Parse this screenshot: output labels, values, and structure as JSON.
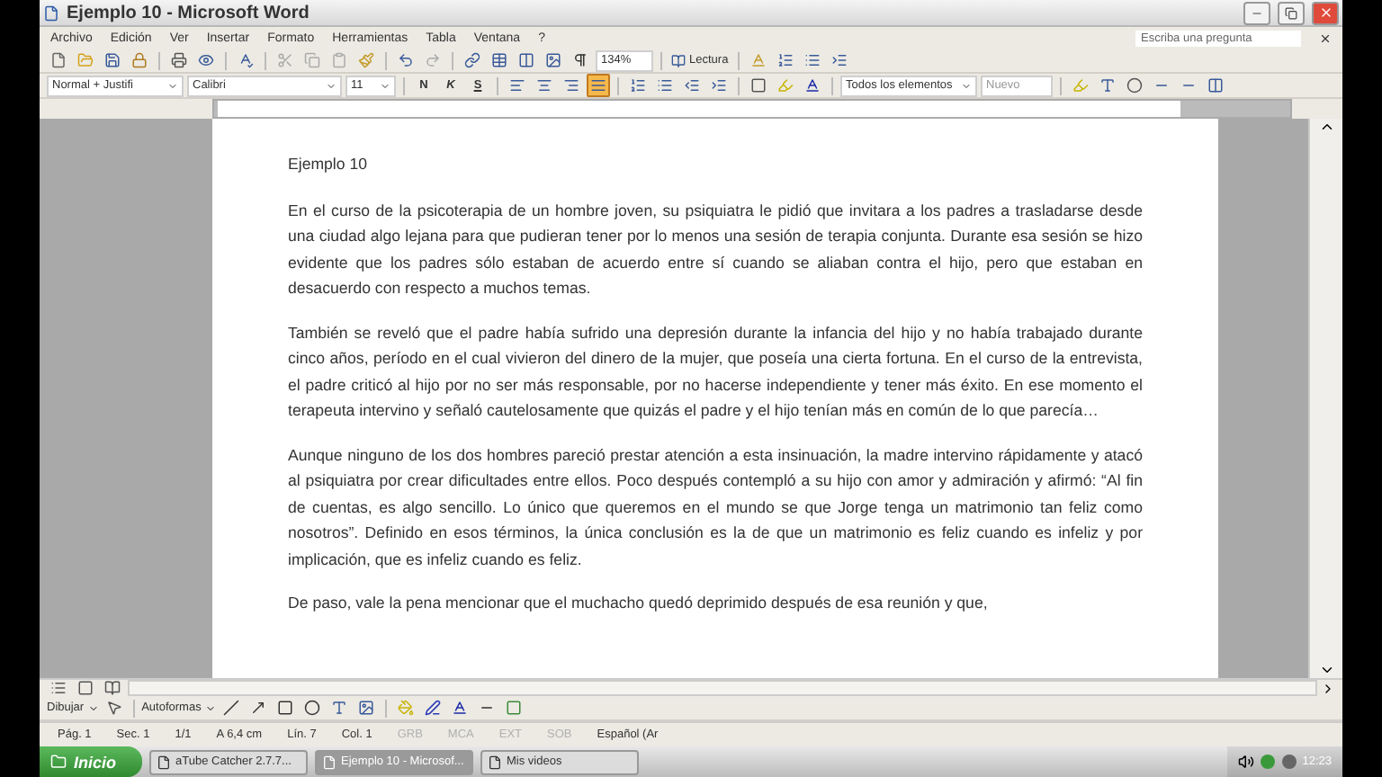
{
  "window": {
    "title": "Ejemplo 10 - Microsoft Word"
  },
  "menu": {
    "items": [
      "Archivo",
      "Edición",
      "Ver",
      "Insertar",
      "Formato",
      "Herramientas",
      "Tabla",
      "Ventana",
      "?"
    ],
    "help_box": {
      "placeholder": "Escriba una pregunta"
    }
  },
  "standard_toolbar": {
    "zoom": "134%",
    "reading_button": "Lectura"
  },
  "format_toolbar": {
    "style": "Normal + Justifi",
    "font": "Calibri",
    "size": "11",
    "bold": "N",
    "italic": "K",
    "underline": "S",
    "alignment_buttons": [
      {
        "selected": false
      },
      {
        "selected": false
      },
      {
        "selected": false
      },
      {
        "selected": true
      }
    ],
    "review_filter": "Todos los elementos",
    "new_comment": "Nuevo"
  },
  "document": {
    "heading": "Ejemplo 10",
    "paragraphs": [
      "En el curso de la psicoterapia de un hombre joven, su psiquiatra le pidió que invitara a los padres a trasladarse desde una ciudad algo lejana para que pudieran tener por lo menos una sesión de terapia conjunta.  Durante esa sesión se hizo evidente que los padres sólo estaban de acuerdo entre sí cuando se aliaban contra el hijo, pero que estaban en desacuerdo con respecto a muchos temas.",
      "También se reveló que el padre había sufrido una depresión durante la infancia del hijo y no había trabajado durante cinco años, período en el cual vivieron del dinero de la mujer, que poseía una cierta fortuna.  En el curso de la entrevista, el padre criticó al hijo por no ser más responsable, por no hacerse independiente y tener más éxito.  En ese momento el terapeuta intervino y señaló cautelosamente que quizás el padre y el hijo tenían más en común de lo que parecía…",
      "Aunque ninguno de los dos hombres pareció prestar atención a esta insinuación, la madre intervino rápidamente y atacó al psiquiatra por crear dificultades entre ellos.  Poco después contempló a su hijo con amor y admiración y afirmó: “Al fin de cuentas, es algo sencillo.  Lo único que queremos en el mundo se que Jorge tenga un matrimonio tan feliz como nosotros”. Definido en esos términos, la única conclusión es la de que un matrimonio es feliz cuando es infeliz y por implicación, que es infeliz cuando es feliz.",
      "De paso, vale la pena mencionar que el muchacho quedó deprimido después de esa reunión y que,"
    ]
  },
  "drawing_toolbar": {
    "draw_menu": "Dibujar",
    "shapes_menu": "Autoformas"
  },
  "status_bar": {
    "fields": [
      {
        "text": "Pág. 1",
        "active": true
      },
      {
        "text": "Sec. 1",
        "active": true
      },
      {
        "text": "1/1",
        "active": true
      },
      {
        "text": "A 6,4 cm",
        "active": true
      },
      {
        "text": "Lín. 7",
        "active": true
      },
      {
        "text": "Col. 1",
        "active": true
      },
      {
        "text": "GRB",
        "active": false
      },
      {
        "text": "MCA",
        "active": false
      },
      {
        "text": "EXT",
        "active": false
      },
      {
        "text": "SOB",
        "active": false
      },
      {
        "text": "Español (Ar",
        "active": true
      }
    ]
  },
  "taskbar": {
    "start": "Inicio",
    "windows": [
      {
        "label": "aTube Catcher 2.7.7...",
        "selected": false
      },
      {
        "label": "Ejemplo 10 - Microsof...",
        "selected": true
      },
      {
        "label": "Mis videos",
        "selected": false
      }
    ],
    "clock": "12:23"
  }
}
